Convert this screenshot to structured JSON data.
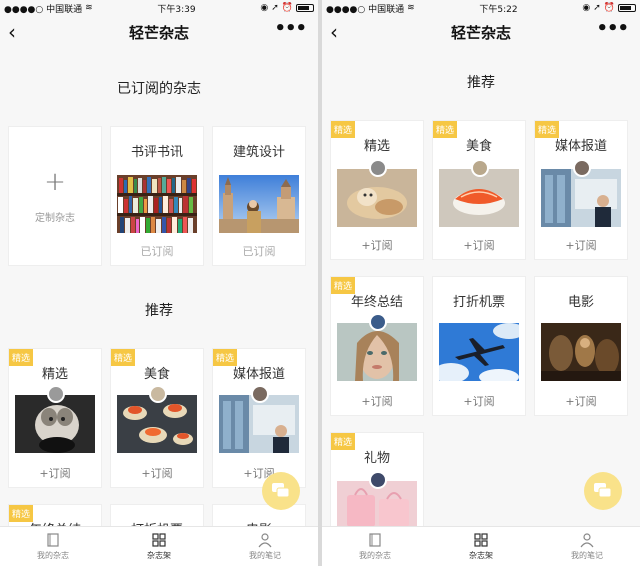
{
  "left": {
    "status": {
      "carrier": "●●●●○ 中国联通",
      "time": "下午3:39"
    },
    "nav": {
      "back": "‹",
      "title": "轻芒杂志",
      "more": "•••"
    },
    "subscribed_title": "已订阅的杂志",
    "custom": {
      "plus": "+",
      "label": "定制杂志"
    },
    "subscribed": [
      {
        "name": "书评书讯",
        "action": "已订阅"
      },
      {
        "name": "建筑设计",
        "action": "已订阅"
      }
    ],
    "recommend_title": "推荐",
    "recommend": [
      {
        "badge": "精选",
        "name": "精选",
        "action": "+订阅"
      },
      {
        "badge": "精选",
        "name": "美食",
        "action": "+订阅"
      },
      {
        "badge": "精选",
        "name": "媒体报道",
        "action": "+订阅"
      },
      {
        "badge": "精选",
        "name": "年终总结"
      },
      {
        "name": "打折机票"
      },
      {
        "name": "电影"
      }
    ],
    "tabs": [
      {
        "label": "我的杂志"
      },
      {
        "label": "杂志架"
      },
      {
        "label": "我的笔记"
      }
    ]
  },
  "right": {
    "status": {
      "carrier": "●●●●○ 中国联通",
      "time": "下午5:22"
    },
    "nav": {
      "back": "‹",
      "title": "轻芒杂志",
      "more": "•••"
    },
    "recommend_title": "推荐",
    "recommend": [
      {
        "badge": "精选",
        "name": "精选",
        "action": "+订阅"
      },
      {
        "badge": "精选",
        "name": "美食",
        "action": "+订阅"
      },
      {
        "badge": "精选",
        "name": "媒体报道",
        "action": "+订阅"
      },
      {
        "badge": "精选",
        "name": "年终总结",
        "action": "+订阅"
      },
      {
        "name": "打折机票",
        "action": "+订阅"
      },
      {
        "name": "电影",
        "action": "+订阅"
      },
      {
        "badge": "精选",
        "name": "礼物"
      }
    ],
    "tabs": [
      {
        "label": "我的杂志"
      },
      {
        "label": "杂志架"
      },
      {
        "label": "我的笔记"
      }
    ]
  },
  "colors": {
    "badge": "#f6c744",
    "fab": "#f9e28a",
    "background": "#f7f7f7"
  },
  "icons": {
    "back": "chevron-left-icon",
    "more": "more-dots-icon",
    "fab": "chat-bubble-icon",
    "tab1": "magazine-icon",
    "tab2": "grid-icon",
    "tab3": "person-icon"
  }
}
